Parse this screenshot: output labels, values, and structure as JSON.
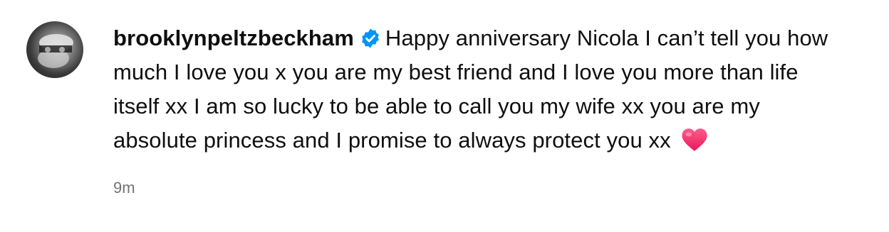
{
  "comment": {
    "username": "brooklynpeltzbeckham",
    "verified_icon": "verified-badge-icon",
    "verified_color": "#0095f6",
    "text": "Happy anniversary Nicola I can’t tell you how much I love you x you are my best friend and I love you more than life itself xx I am so lucky to be able to call you my wife xx you are my absolute princess and I promise to always protect you xx",
    "emoji_icon": "pink-heart-icon",
    "timestamp": "9m"
  }
}
